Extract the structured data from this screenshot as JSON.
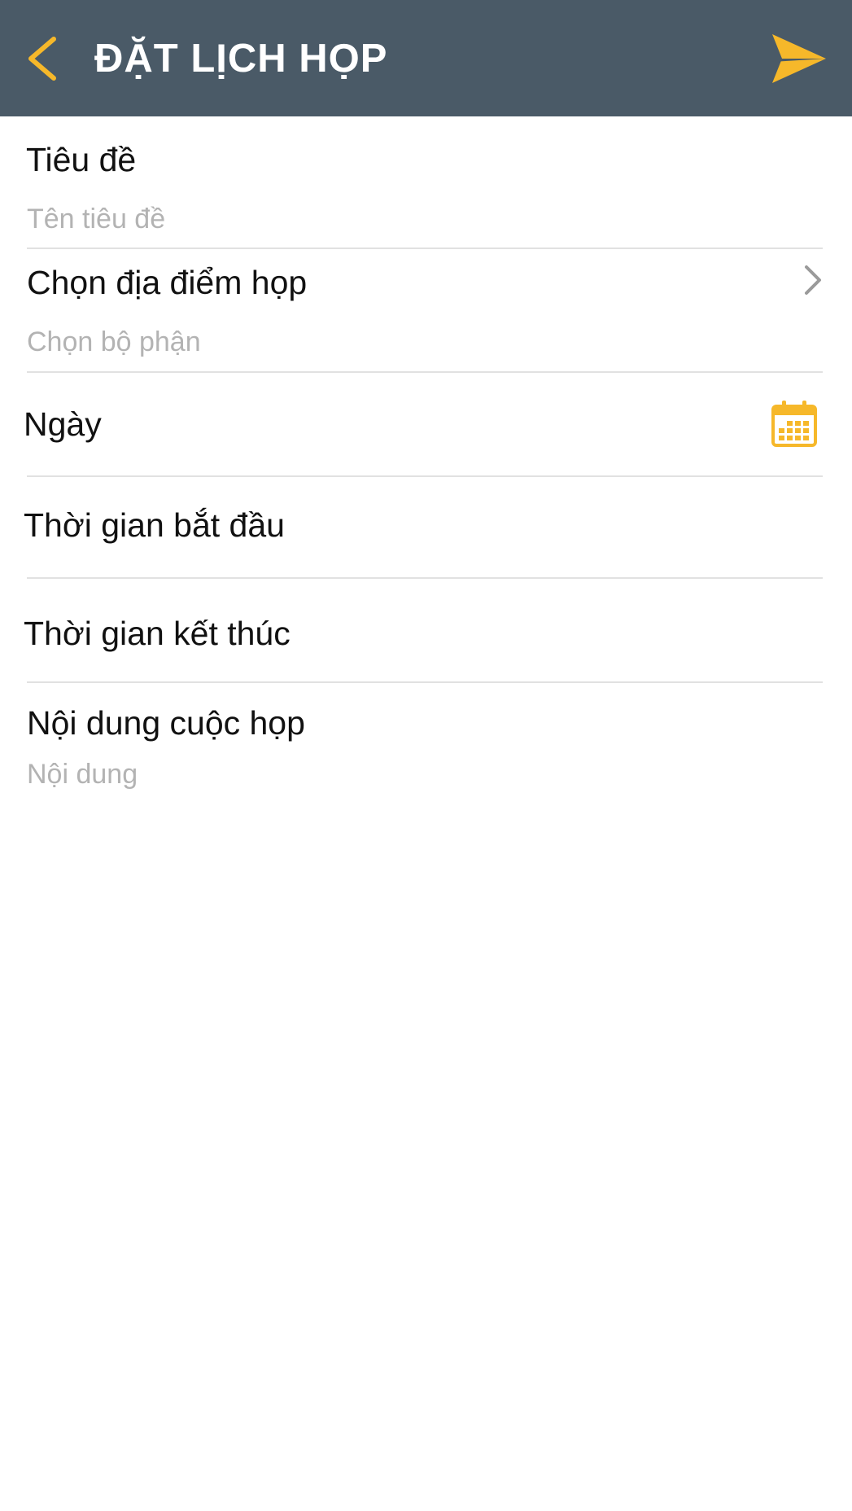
{
  "header": {
    "title": "ĐẶT LỊCH HỌP",
    "background": "#4a5a67",
    "accent": "#f6b82a",
    "back_icon": "chevron-left-icon",
    "send_icon": "send-icon"
  },
  "form": {
    "title": {
      "label": "Tiêu đề",
      "value": "",
      "placeholder": "Tên tiêu đề"
    },
    "location": {
      "label": "Chọn địa điểm họp",
      "value": "",
      "placeholder": "Chọn bộ phận",
      "icon": "chevron-right-icon"
    },
    "date": {
      "label": "Ngày",
      "icon": "calendar-icon"
    },
    "start_time": {
      "label": "Thời gian bắt đầu"
    },
    "end_time": {
      "label": "Thời gian kết thúc"
    },
    "content": {
      "label": "Nội dung cuộc họp",
      "value": "",
      "placeholder": "Nội dung"
    }
  }
}
